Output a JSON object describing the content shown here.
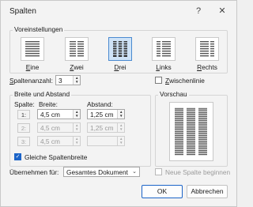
{
  "window": {
    "title": "Spalten",
    "help": "?",
    "close": "✕"
  },
  "presets": {
    "legend": "Voreinstellungen",
    "items": [
      {
        "label_u": "E",
        "label_rest": "ine",
        "selected": false,
        "icon": "one-column-icon"
      },
      {
        "label_u": "Z",
        "label_rest": "wei",
        "selected": false,
        "icon": "two-columns-icon"
      },
      {
        "label_u": "D",
        "label_rest": "rei",
        "selected": true,
        "icon": "three-columns-icon"
      },
      {
        "label_u": "L",
        "label_rest": "inks",
        "selected": false,
        "icon": "left-column-icon"
      },
      {
        "label_u": "R",
        "label_rest": "echts",
        "selected": false,
        "icon": "right-column-icon"
      }
    ]
  },
  "column_count": {
    "label_u": "S",
    "label_rest": "paltenanzahl:",
    "value": "3"
  },
  "line_between": {
    "label_u": "Z",
    "label_rest": "wischenlinie",
    "checked": false
  },
  "width_spacing": {
    "legend": "Breite und Abstand",
    "header_col": "Spalte:",
    "header_col_u": "l",
    "header_width": "Breite:",
    "header_spacing": "Abstand:",
    "rows": [
      {
        "num": "1:",
        "width": "4,5 cm",
        "spacing": "1,25 cm",
        "disabled": false
      },
      {
        "num": "2:",
        "width": "4,5 cm",
        "spacing": "1,25 cm",
        "disabled": true
      },
      {
        "num": "3:",
        "width": "4,5 cm",
        "spacing": "",
        "disabled": true
      }
    ],
    "equal_width": {
      "label": "Gleiche Spaltenbreite",
      "checked": true
    }
  },
  "preview": {
    "legend": "Vorschau"
  },
  "apply_to": {
    "label": "Übernehmen für:",
    "value": "Gesamtes Dokument"
  },
  "new_column": {
    "label": "Neue Spalte beginnen",
    "checked": false,
    "disabled": true
  },
  "buttons": {
    "ok": "OK",
    "cancel": "Abbrechen"
  }
}
